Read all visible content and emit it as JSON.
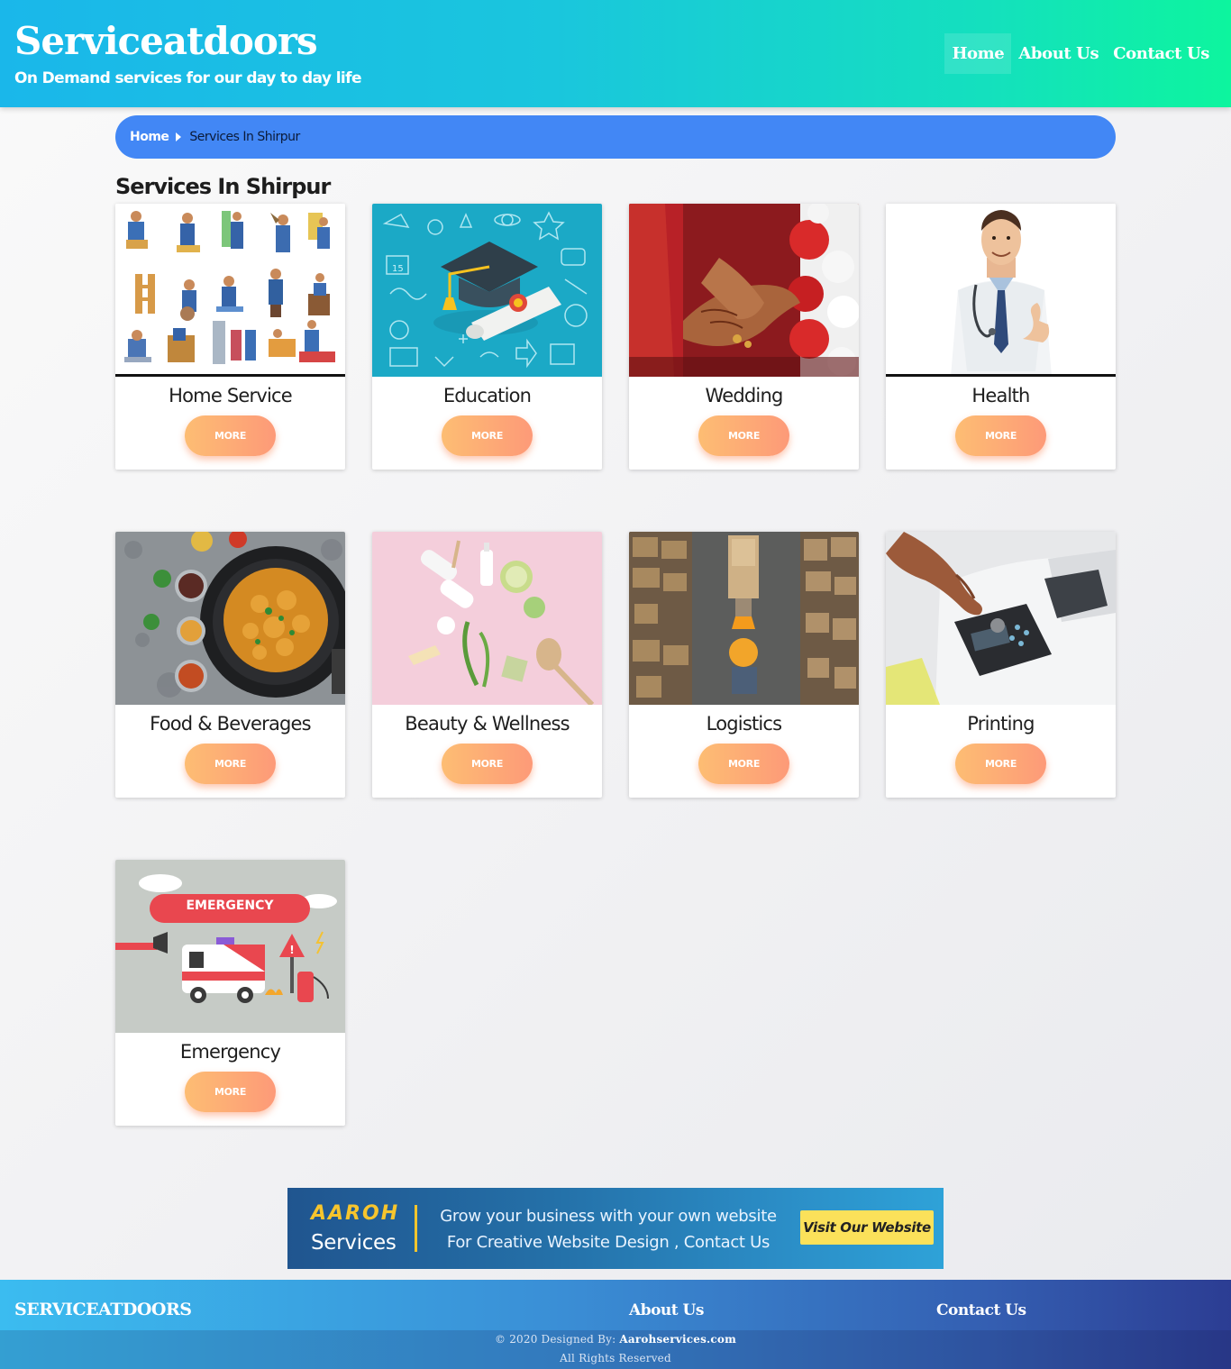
{
  "header": {
    "brand": "Serviceatdoors",
    "tagline": "On Demand services for our day to day life",
    "nav": [
      {
        "label": "Home",
        "active": true
      },
      {
        "label": "About Us",
        "active": false
      },
      {
        "label": "Contact Us",
        "active": false
      }
    ]
  },
  "breadcrumb": {
    "home": "Home",
    "current": "Services In Shirpur"
  },
  "page_title": "Services In Shirpur",
  "services": [
    {
      "title": "Home Service",
      "button": "MORE",
      "image": "isometric-workers-illustration"
    },
    {
      "title": "Education",
      "button": "MORE",
      "image": "graduation-cap-illustration"
    },
    {
      "title": "Wedding",
      "button": "MORE",
      "image": "wedding-hands-photo"
    },
    {
      "title": "Health",
      "button": "MORE",
      "image": "doctor-photo"
    },
    {
      "title": "Food & Beverages",
      "button": "MORE",
      "image": "curry-pan-photo"
    },
    {
      "title": "Beauty & Wellness",
      "button": "MORE",
      "image": "spa-items-photo"
    },
    {
      "title": "Logistics",
      "button": "MORE",
      "image": "warehouse-photo"
    },
    {
      "title": "Printing",
      "button": "MORE",
      "image": "printer-photo"
    },
    {
      "title": "Emergency",
      "button": "MORE",
      "image": "ambulance-illustration",
      "image_text": "EMERGENCY"
    }
  ],
  "banner": {
    "logo": "AAROH",
    "logo_sub": "Services",
    "line1": "Grow your business with your own website",
    "line2": "For Creative Website Design , Contact Us",
    "button": "Visit Our Website"
  },
  "footer": {
    "brand": "SERVICEATDOORS",
    "links": [
      "About Us",
      "Contact Us"
    ],
    "copyright_prefix": "© 2020 Designed By:",
    "copyright_site": "Aarohservices.com",
    "rights": "All Rights Reserved"
  },
  "colors": {
    "header_gradient_start": "#1ab7ea",
    "header_gradient_end": "#0df59e",
    "breadcrumb_bg": "#4287f5",
    "button_gradient_start": "#fdbd73",
    "button_gradient_end": "#fd9a78",
    "banner_accent": "#f7c52d",
    "banner_button_bg": "#fbe15a",
    "footer_gradient_start": "#3bbcf0",
    "footer_gradient_end": "#2c3d93"
  }
}
